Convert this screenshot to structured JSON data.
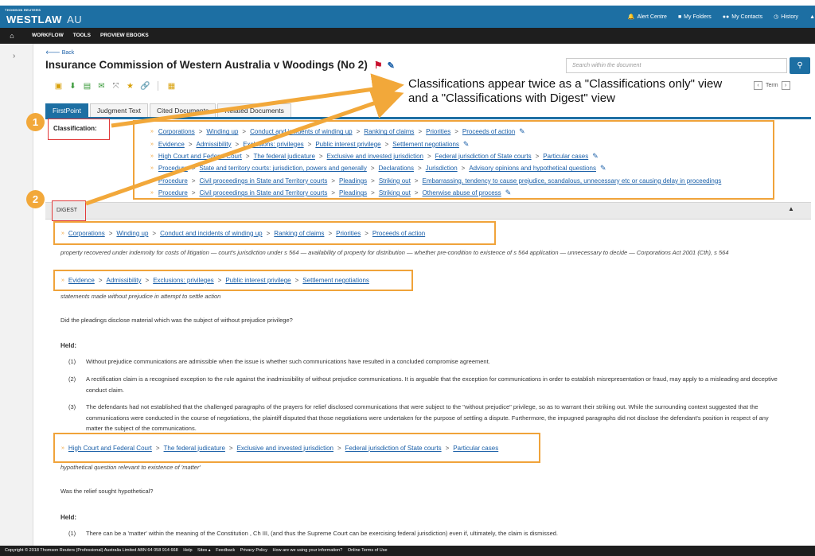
{
  "header": {
    "brand_small": "THOMSON REUTERS",
    "brand": "WESTLAW",
    "brand_region": "AU",
    "links": [
      {
        "icon": "bell-icon",
        "label": "Alert Centre"
      },
      {
        "icon": "folder-icon",
        "label": "My Folders"
      },
      {
        "icon": "contacts-icon",
        "label": "My Contacts"
      },
      {
        "icon": "clock-icon",
        "label": "History"
      }
    ]
  },
  "nav": {
    "items": [
      "WORKFLOW",
      "TOOLS",
      "PROVIEW EBOOKS"
    ]
  },
  "document": {
    "back_label": "Back",
    "title": "Insurance Commission of Western Australia v Woodings (No 2)",
    "search_placeholder": "Search within the document",
    "term_label": "Term"
  },
  "tabs": [
    "FirstPoint",
    "Judgment Text",
    "Cited Documents",
    "Related Documents"
  ],
  "classification": {
    "label": "Classification:",
    "rows": [
      [
        "Corporations",
        "Winding up",
        "Conduct and incidents of winding up",
        "Ranking of claims",
        "Priorities",
        "Proceeds of action"
      ],
      [
        "Evidence",
        "Admissibility",
        "Exclusions: privileges",
        "Public interest privilege",
        "Settlement negotiations"
      ],
      [
        "High Court and Federal Court",
        "The federal judicature",
        "Exclusive and invested jurisdiction",
        "Federal jurisdiction of State courts",
        "Particular cases"
      ],
      [
        "Procedure",
        "State and territory courts: jurisdiction, powers and generally",
        "Declarations",
        "Jurisdiction",
        "Advisory opinions and hypothetical questions"
      ],
      [
        "Procedure",
        "Civil proceedings in State and Territory courts",
        "Pleadings",
        "Striking out",
        "Embarrassing, tendency to cause prejudice, scandalous, unnecessary etc or causing delay in proceedings"
      ],
      [
        "Procedure",
        "Civil proceedings in State and Territory courts",
        "Pleadings",
        "Striking out",
        "Otherwise abuse of process"
      ]
    ]
  },
  "digest": {
    "label": "DIGEST",
    "crumbs1": [
      "Corporations",
      "Winding up",
      "Conduct and incidents of winding up",
      "Ranking of claims",
      "Priorities",
      "Proceeds of action"
    ],
    "summary1": "property recovered under indemnity for costs of litigation — court's jurisdiction under s 564 — availability of property for distribution — whether pre-condition to existence of s 564 application — unnecessary to decide — Corporations Act 2001  (Cth), s 564",
    "crumbs2": [
      "Evidence",
      "Admissibility",
      "Exclusions: privileges",
      "Public interest privilege",
      "Settlement negotiations"
    ],
    "summary2": "statements made without prejudice in attempt to settle action",
    "question1": "Did the pleadings disclose material which was the subject of without prejudice privilege?",
    "held_label": "Held:",
    "held1": [
      {
        "n": "(1)",
        "text": "Without prejudice communications are admissible when the issue is whether such communications have resulted in a concluded compromise agreement."
      },
      {
        "n": "(2)",
        "text": "A rectification claim is a recognised exception to the rule against the inadmissibility of without prejudice communications. It is arguable that the exception for communications in order to establish misrepresentation or fraud, may apply to a misleading and deceptive conduct claim."
      },
      {
        "n": "(3)",
        "text": "The defendants had not established that the challenged paragraphs of the prayers for relief disclosed communications that were subject to the \"without prejudice\" privilege, so as to warrant their striking out. While the surrounding context suggested that the communications were conducted in the course of negotiations, the plaintiff disputed that those negotiations were undertaken for the purpose of settling a dispute. Furthermore, the impugned paragraphs did not disclose the defendant's position in respect of any matter the subject of the communications."
      }
    ],
    "crumbs3": [
      "High Court and Federal Court",
      "The federal judicature",
      "Exclusive and invested jurisdiction",
      "Federal jurisdiction of State courts",
      "Particular cases"
    ],
    "summary3": "hypothetical question relevant to existence of 'matter'",
    "question2": "Was the relief sought hypothetical?",
    "held2": [
      {
        "n": "(1)",
        "text": "There can be a 'matter' within the meaning of the Constitution , Ch III, (and thus the Supreme Court can be exercising federal jurisdiction) even if, ultimately, the claim is dismissed."
      }
    ]
  },
  "footer": {
    "copyright": "Copyright © 2018 Thomson Reuters (Professional) Australia Limited ABN 64 058 914 668",
    "links": [
      "Help",
      "Sites ▴",
      "Feedback",
      "Privacy Policy",
      "How are we using your information?",
      "Online Terms of Use"
    ]
  },
  "annotation": {
    "callout": "Classifications appear twice as a \"Classifications only\" view and a \"Classifications with Digest\" view",
    "badge1": "1",
    "badge2": "2",
    "color": "#f2a83a"
  }
}
